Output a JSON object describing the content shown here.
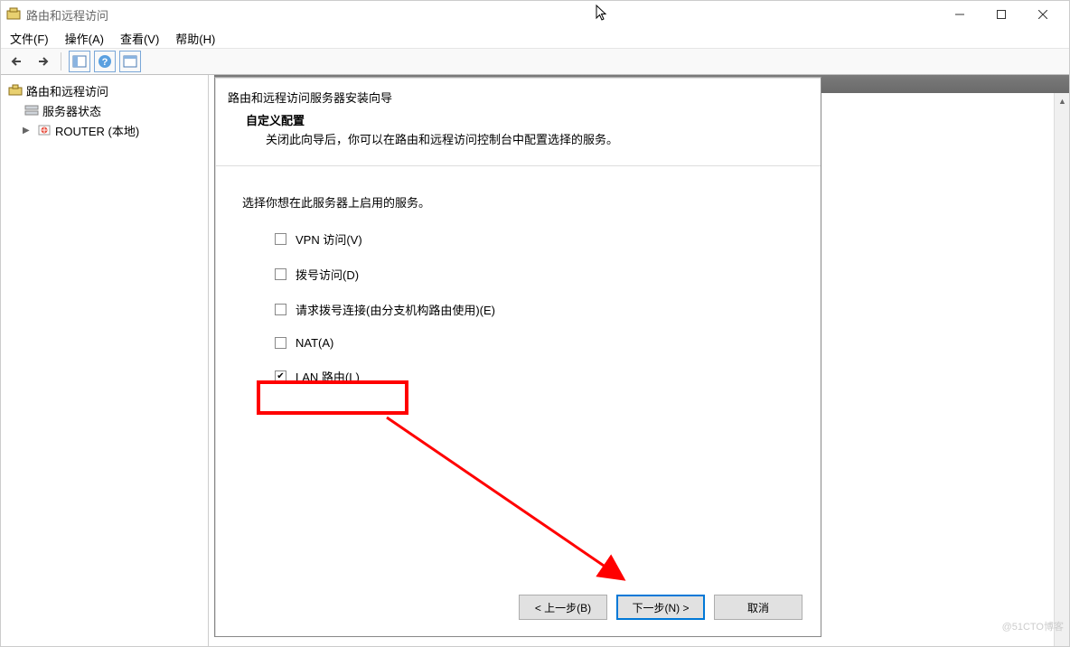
{
  "window": {
    "title": "路由和远程访问"
  },
  "menubar": {
    "file": "文件(F)",
    "action": "操作(A)",
    "view": "查看(V)",
    "help": "帮助(H)"
  },
  "tree": {
    "root": "路由和远程访问",
    "serverStatus": "服务器状态",
    "router": "ROUTER (本地)"
  },
  "dialog": {
    "title": "路由和远程访问服务器安装向导",
    "subTitle": "自定义配置",
    "subDesc": "关闭此向导后，你可以在路由和远程访问控制台中配置选择的服务。",
    "instruction": "选择你想在此服务器上启用的服务。",
    "options": {
      "vpn": {
        "label": "VPN 访问(V)",
        "checked": false
      },
      "dial": {
        "label": "拨号访问(D)",
        "checked": false
      },
      "demand": {
        "label": "请求拨号连接(由分支机构路由使用)(E)",
        "checked": false
      },
      "nat": {
        "label": "NAT(A)",
        "checked": false
      },
      "lan": {
        "label": "LAN 路由(L)",
        "checked": true
      }
    },
    "buttons": {
      "back": "< 上一步(B)",
      "next": "下一步(N) >",
      "cancel": "取消"
    }
  },
  "watermark": "@51CTO博客"
}
